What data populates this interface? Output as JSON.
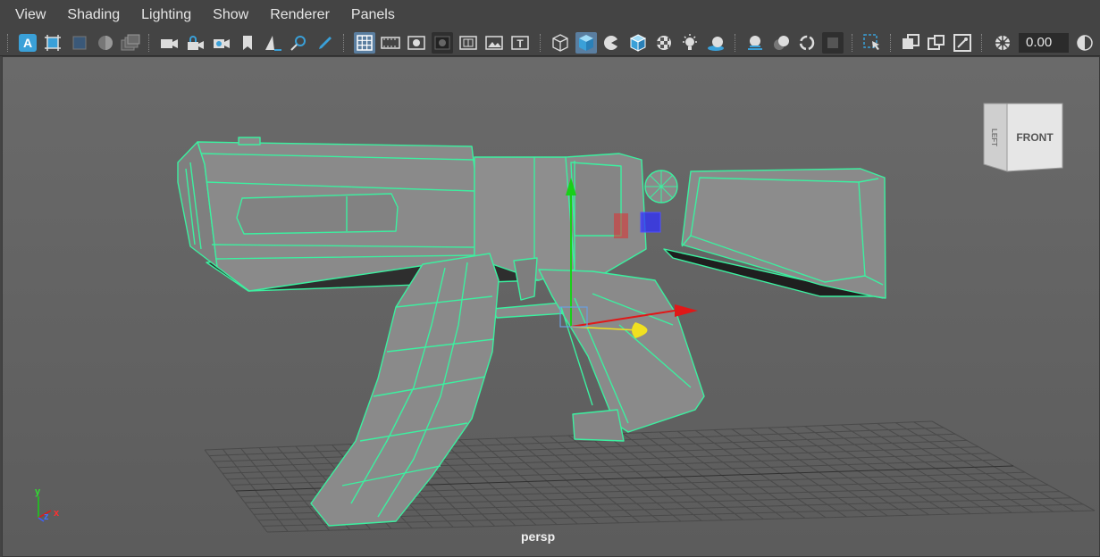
{
  "menu": [
    "View",
    "Shading",
    "Lighting",
    "Show",
    "Renderer",
    "Panels"
  ],
  "toolbar": {
    "field_value": "0.00",
    "icons": [
      "select-camera-icon",
      "lock-camera-icon",
      "camera-attributes-icon",
      "bookmarks-icon",
      "image-plane-icon",
      "2d-pan-zoom-icon",
      "grease-pencil-icon",
      "grid-icon",
      "film-gate-icon",
      "resolution-gate-icon",
      "gate-mask-icon",
      "field-chart-icon",
      "safe-action-icon",
      "safe-title-icon",
      "wireframe-icon",
      "smooth-shade-icon",
      "use-default-material-icon",
      "wireframe-on-shaded-icon",
      "textured-icon",
      "use-all-lights-icon",
      "shadows-icon",
      "screen-space-ao-icon",
      "motion-blur-icon",
      "multisample-aa-icon",
      "depth-of-field-icon",
      "isolate-select-icon",
      "xray-icon",
      "xray-active-components-icon",
      "xray-joints-icon",
      "exposure-icon",
      "gamma-icon"
    ]
  },
  "viewcube": {
    "left_label": "LEFT",
    "front_label": "FRONT"
  },
  "axes": {
    "x": "x",
    "y": "y",
    "z": "z"
  },
  "viewport": {
    "camera": "persp"
  },
  "colors": {
    "wireframe": "#3cf0a0",
    "surface": "#8a8a8a",
    "dark_surface": "#2e2e2e",
    "x_axis": "#e01818",
    "y_axis": "#18d018",
    "z_axis": "#3030ff",
    "pivot": "#f0e020"
  }
}
